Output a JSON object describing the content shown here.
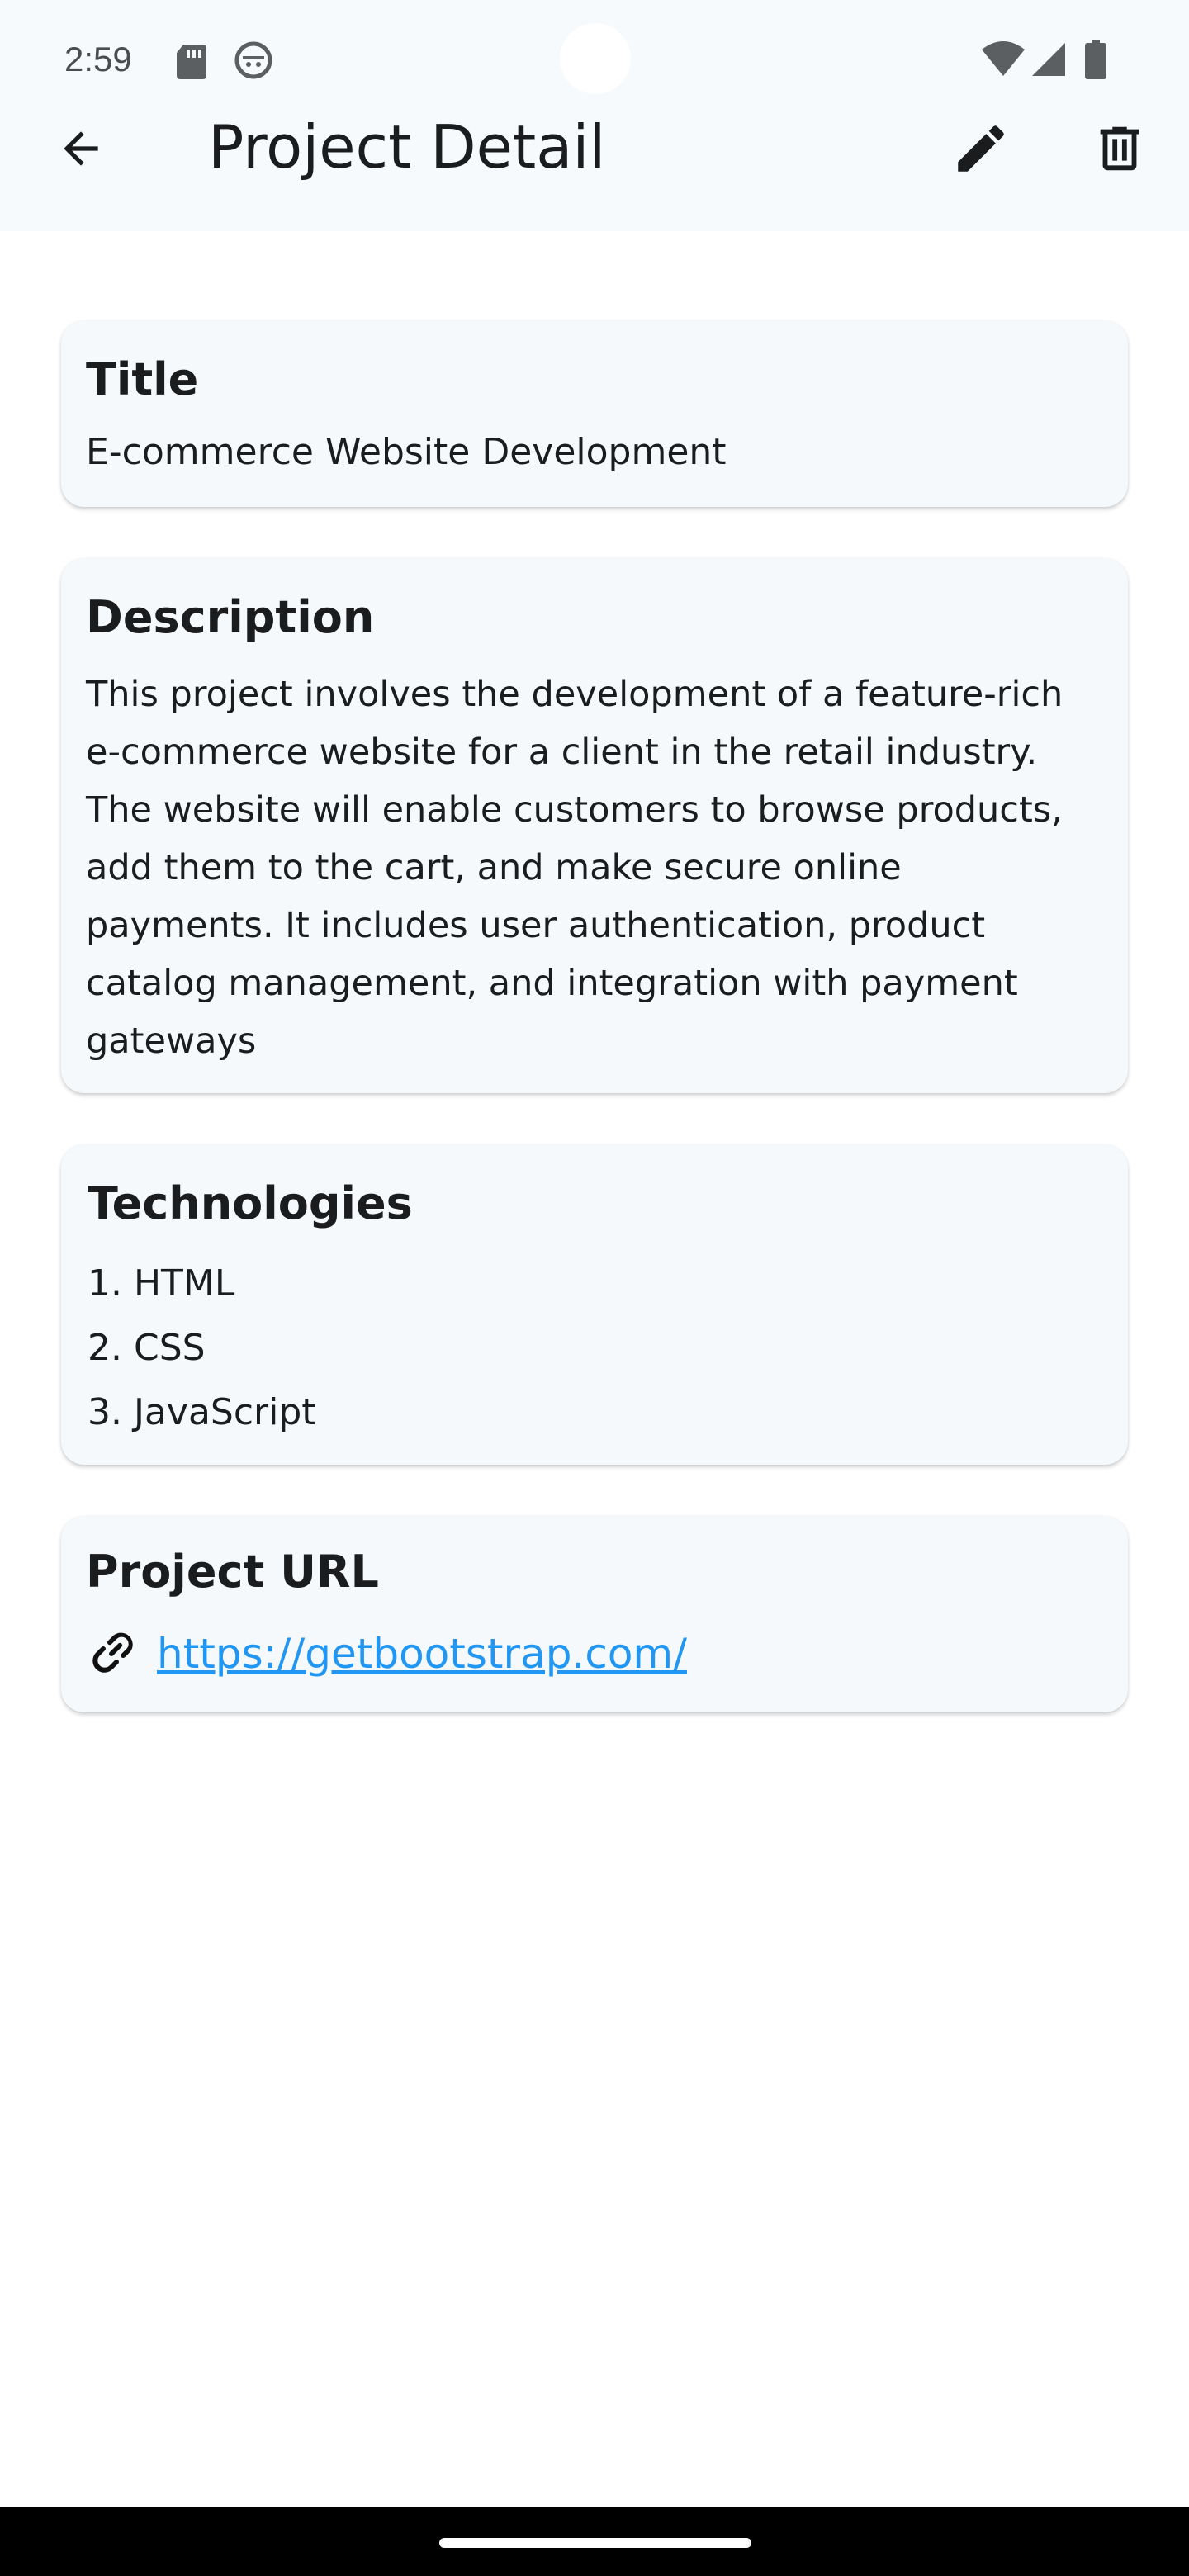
{
  "status_bar": {
    "time": "2:59",
    "icons": [
      "sd-card-icon",
      "android-debug-icon",
      "wifi-icon",
      "signal-icon",
      "battery-icon"
    ]
  },
  "app_bar": {
    "title": "Project Detail",
    "back_icon": "arrow-left-icon",
    "edit_icon": "pencil-icon",
    "delete_icon": "trash-icon"
  },
  "cards": {
    "title": {
      "heading": "Title",
      "value": "E-commerce Website Development"
    },
    "description": {
      "heading": "Description",
      "value": "This project involves the development of a feature-rich e-commerce website for a client in the retail industry. The website will enable customers to browse products, add them to the cart, and make secure online payments. It includes user authentication, product catalog management, and integration with payment gateways"
    },
    "technologies": {
      "heading": "Technologies",
      "items": [
        "1. HTML",
        "2. CSS",
        "3. JavaScript"
      ]
    },
    "project_url": {
      "heading": "Project URL",
      "link_icon": "link-icon",
      "url": "https://getbootstrap.com/"
    }
  },
  "colors": {
    "app_bar_bg": "#f6fafc",
    "card_bg": "#f6f9fb",
    "link": "#2196f3",
    "text": "#1b1c1e"
  }
}
